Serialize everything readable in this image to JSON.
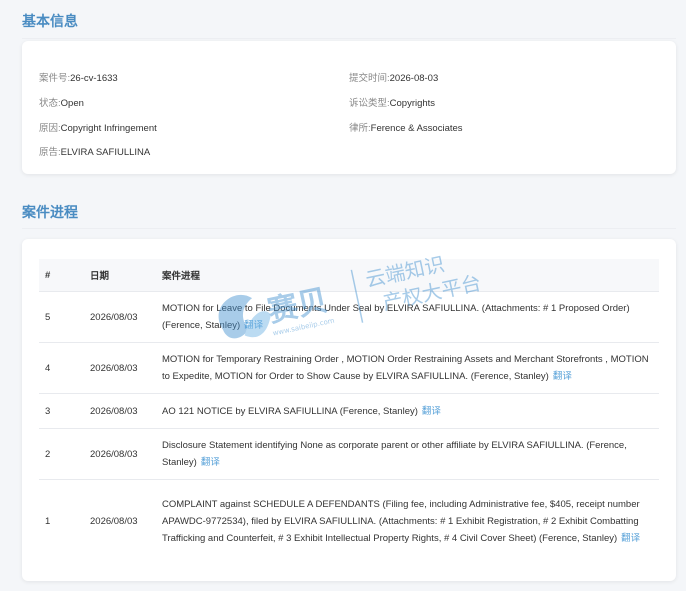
{
  "basic_info": {
    "title": "基本信息",
    "case_no_label": "案件号:",
    "case_no": "26-cv-1633",
    "submit_time_label": "提交时间:",
    "submit_time": "2026-08-03",
    "status_label": "状态:",
    "status": "Open",
    "suit_type_label": "诉讼类型:",
    "suit_type": "Copyrights",
    "cause_label": "原因:",
    "cause": "Copyright Infringement",
    "law_firm_label": "律所:",
    "law_firm": "Ference & Associates",
    "plaintiff_label": "原告:",
    "plaintiff": "ELVIRA SAFIULLINA"
  },
  "progress": {
    "title": "案件进程",
    "headers": {
      "idx": "#",
      "date": "日期",
      "event": "案件进程"
    },
    "translate_label": "翻译",
    "rows": [
      {
        "idx": "5",
        "date": "2026/08/03",
        "text": "MOTION for Leave to File Documents Under Seal by ELVIRA SAFIULLINA. (Attachments: # 1 Proposed Order) (Ference, Stanley)"
      },
      {
        "idx": "4",
        "date": "2026/08/03",
        "text": "MOTION for Temporary Restraining Order , MOTION Order Restraining Assets and Merchant Storefronts , MOTION to Expedite, MOTION for Order to Show Cause by ELVIRA SAFIULLINA. (Ference, Stanley)"
      },
      {
        "idx": "3",
        "date": "2026/08/03",
        "text": "AO 121 NOTICE by ELVIRA SAFIULLINA (Ference, Stanley)"
      },
      {
        "idx": "2",
        "date": "2026/08/03",
        "text": "Disclosure Statement identifying None as corporate parent or other affiliate by ELVIRA SAFIULLINA. (Ference, Stanley)"
      },
      {
        "idx": "1",
        "date": "2026/08/03",
        "text": "COMPLAINT against SCHEDULE A DEFENDANTS (Filing fee, including Administrative fee, $405, receipt number APAWDC-9772534), filed by ELVIRA SAFIULLINA. (Attachments: # 1 Exhibit Registration, # 2 Exhibit Combatting Trafficking and Counterfeit, # 3 Exhibit Intellectual Property Rights, # 4 Civil Cover Sheet) (Ference, Stanley)"
      }
    ]
  },
  "watermark": {
    "brand": "赛贝",
    "domain": "www.saibeiip.com",
    "line1": "云端知识",
    "line2": "产权大平台"
  }
}
